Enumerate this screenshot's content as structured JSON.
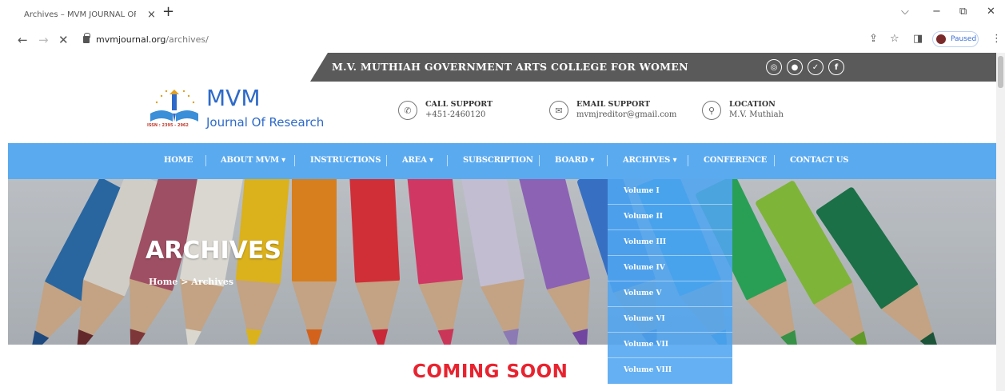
{
  "browser": {
    "tab_title": "Archives – MVM JOURNAL OF F",
    "tab_close": "×",
    "new_tab": "+",
    "url_host": "mvmjournal.org",
    "url_path": "/archives/",
    "profile_status": "Paused",
    "nav": {
      "back": "←",
      "forward": "→",
      "stop": "✕"
    },
    "window": {
      "minimize_chevron": "⌵",
      "minimize": "−",
      "restore": "⧉",
      "close": "✕"
    },
    "toolbar_icons": {
      "share": "⇪",
      "star": "☆",
      "sidebar": "◨",
      "menu": "⋮"
    }
  },
  "site": {
    "college_name": "M.V. MUTHIAH GOVERNMENT ARTS COLLEGE FOR WOMEN",
    "social": [
      {
        "name": "instagram-icon",
        "glyph": "◎"
      },
      {
        "name": "social-icon-2",
        "glyph": "●"
      },
      {
        "name": "twitter-icon",
        "glyph": "✓"
      },
      {
        "name": "facebook-icon",
        "glyph": "f"
      }
    ],
    "logo": {
      "title": "MVM",
      "subtitle": "Journal Of Research",
      "issn": "ISSN : 2395 - 2962"
    },
    "contacts": [
      {
        "label": "CALL SUPPORT",
        "value": "+451-2460120",
        "icon": "phone-icon",
        "glyph": "✆"
      },
      {
        "label": "EMAIL SUPPORT",
        "value": "mvmjreditor@gmail.com",
        "icon": "email-icon",
        "glyph": "✉"
      },
      {
        "label": "LOCATION",
        "value": "M.V. Muthiah",
        "icon": "location-icon",
        "glyph": "⚲"
      }
    ],
    "nav": [
      {
        "label": "HOME"
      },
      {
        "label": "ABOUT MVM",
        "caret": "▾"
      },
      {
        "label": "INSTRUCTIONS"
      },
      {
        "label": "AREA",
        "caret": "▾"
      },
      {
        "label": "SUBSCRIPTION"
      },
      {
        "label": "BOARD",
        "caret": "▾"
      },
      {
        "label": "ARCHIVES",
        "caret": "▾"
      },
      {
        "label": "CONFERENCE"
      },
      {
        "label": "CONTACT US"
      }
    ],
    "hero": {
      "title": "ARCHIVES",
      "crumb_home": "Home",
      "crumb_sep": ">",
      "crumb_current": "Archives"
    },
    "archives_menu": [
      "Volume I",
      "Volume II",
      "Volume III",
      "Volume IV",
      "Volume V",
      "Volume VI",
      "Volume VII",
      "Volume VIII"
    ],
    "coming_soon": "COMING SOON"
  },
  "colors": {
    "nav_blue": "#5aaaf0",
    "topbar_gray": "#5a5a5a",
    "logo_blue": "#2e6ac9",
    "coming_red": "#e8232f"
  }
}
